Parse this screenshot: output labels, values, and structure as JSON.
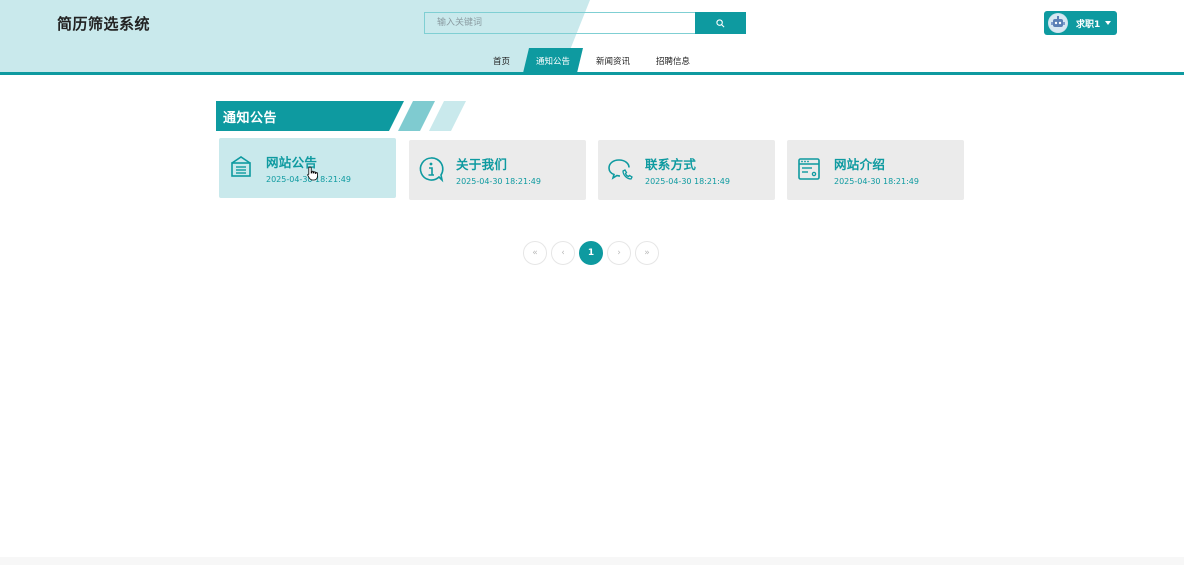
{
  "header": {
    "site_title": "简历筛选系统",
    "search_placeholder": "输入关键词",
    "user_name": "求职1",
    "accent_color": "#0e9aa0",
    "header_tint": "#c9e9ec"
  },
  "nav": {
    "items": [
      {
        "label": "首页",
        "active": false
      },
      {
        "label": "通知公告",
        "active": true
      },
      {
        "label": "新闻资讯",
        "active": false
      },
      {
        "label": "招聘信息",
        "active": false
      }
    ]
  },
  "section": {
    "title": "通知公告"
  },
  "cards": [
    {
      "title": "网站公告",
      "date": "2025-04-30 18:21:49",
      "icon": "announcement-icon",
      "hovered": true
    },
    {
      "title": "关于我们",
      "date": "2025-04-30 18:21:49",
      "icon": "info-icon",
      "hovered": false
    },
    {
      "title": "联系方式",
      "date": "2025-04-30 18:21:49",
      "icon": "chat-phone-icon",
      "hovered": false
    },
    {
      "title": "网站介绍",
      "date": "2025-04-30 18:21:49",
      "icon": "browser-window-icon",
      "hovered": false
    }
  ],
  "pagination": {
    "first": "«",
    "prev": "‹",
    "current": "1",
    "next": "›",
    "last": "»"
  }
}
